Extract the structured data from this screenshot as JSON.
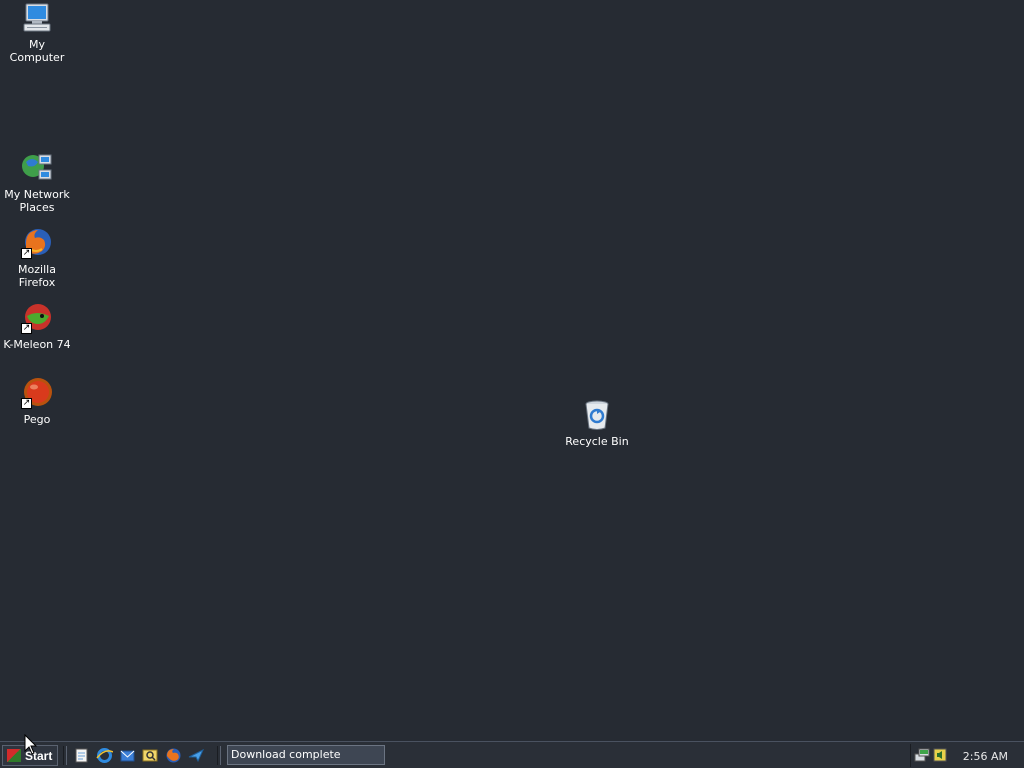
{
  "desktop": {
    "icons": [
      {
        "label": "My Computer",
        "icon": "computer-icon"
      },
      {
        "label": "My Network Places",
        "icon": "network-icon"
      },
      {
        "label": "Mozilla Firefox",
        "icon": "firefox-icon"
      },
      {
        "label": "K-Meleon 74",
        "icon": "kmeleon-icon"
      },
      {
        "label": "Pego",
        "icon": "pego-icon"
      },
      {
        "label": "Recycle Bin",
        "icon": "recycle-bin-icon"
      }
    ]
  },
  "taskbar": {
    "start_label": "Start",
    "quick_launch": [
      "notepad-icon",
      "internet-explorer-icon",
      "outlook-icon",
      "search-icon",
      "firefox-icon",
      "messenger-icon"
    ],
    "task_button": "Download complete",
    "tray_icons": [
      "network-tray-icon",
      "volume-tray-icon"
    ],
    "clock": "2:56 AM"
  },
  "colors": {
    "desktop_bg": "#262b33",
    "taskbar_bg": "#2a2f37"
  }
}
